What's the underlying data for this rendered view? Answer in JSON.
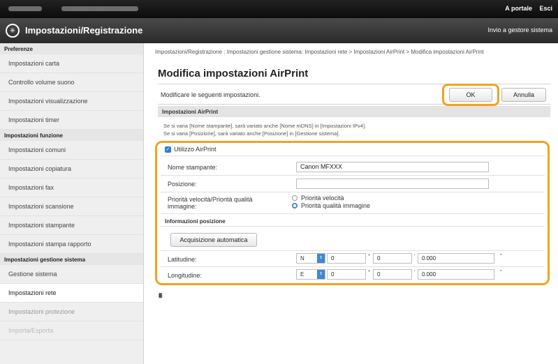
{
  "topbar": {
    "link_portal": "A portale",
    "link_exit": "Esci"
  },
  "header": {
    "title": "Impostazioni/Registrazione",
    "right_link": "Invio a gestore sistema"
  },
  "sidebar": {
    "sections": [
      {
        "title": "Preferenze",
        "items": [
          "Impostazioni carta",
          "Controllo volume suono",
          "Impostazioni visualizzazione",
          "Impostazioni timer"
        ]
      },
      {
        "title": "Impostazioni funzione",
        "items": [
          "Impostazioni comuni",
          "Impostazioni copiatura",
          "Impostazioni fax",
          "Impostazioni scansione",
          "Impostazioni stampante",
          "Impostazioni stampa rapporto"
        ]
      },
      {
        "title": "Impostazioni gestione sistema",
        "items": [
          "Gestione sistema",
          "Impostazioni rete",
          "Impostazioni protezione",
          "Importa/Esporta"
        ]
      }
    ]
  },
  "main": {
    "breadcrumb": "Impostazioni/Registrazione : Impostazioni gestione sistema: Impostazioni rete > Impostazioni AirPrint > Modifica impostazioni AirPrint",
    "title": "Modifica impostazioni AirPrint",
    "instruction": "Modificare le seguenti impostazioni.",
    "ok_label": "OK",
    "cancel_label": "Annulla",
    "section_title": "Impostazioni AirPrint",
    "note1": "Se si varia [Nome stampante], sarà variato anche [Nome mDNS] in [Impostazioni IPv4].",
    "note2": "Se si varia [Posizione], sarà variato anche [Posizione] in [Gestione sistema].",
    "use_airprint_label": "Utilizzo AirPrint",
    "use_airprint_checked": true,
    "printer_name_label": "Nome stampante:",
    "printer_name_value": "Canon MFXXX",
    "location_label": "Posizione:",
    "location_value": "",
    "priority_label": "Priorità velocità/Priorità qualità immagine:",
    "priority_options": [
      "Priorità velocità",
      "Priorità qualità immagine"
    ],
    "priority_selected": "Priorità qualità immagine",
    "location_info_title": "Informazioni posizione",
    "auto_acquire_label": "Acquisizione automatica",
    "latitude_label": "Latitudine:",
    "latitude": {
      "dir": "N",
      "deg": "0",
      "min": "0",
      "sec": "0.000"
    },
    "longitude_label": "Longitudine:",
    "longitude": {
      "dir": "E",
      "deg": "0",
      "min": "0",
      "sec": "0.000"
    },
    "units": {
      "deg": "°",
      "min": "'",
      "sec": "\""
    }
  },
  "colors": {
    "highlight": "#f4a21d",
    "accent": "#2f7fd6"
  }
}
